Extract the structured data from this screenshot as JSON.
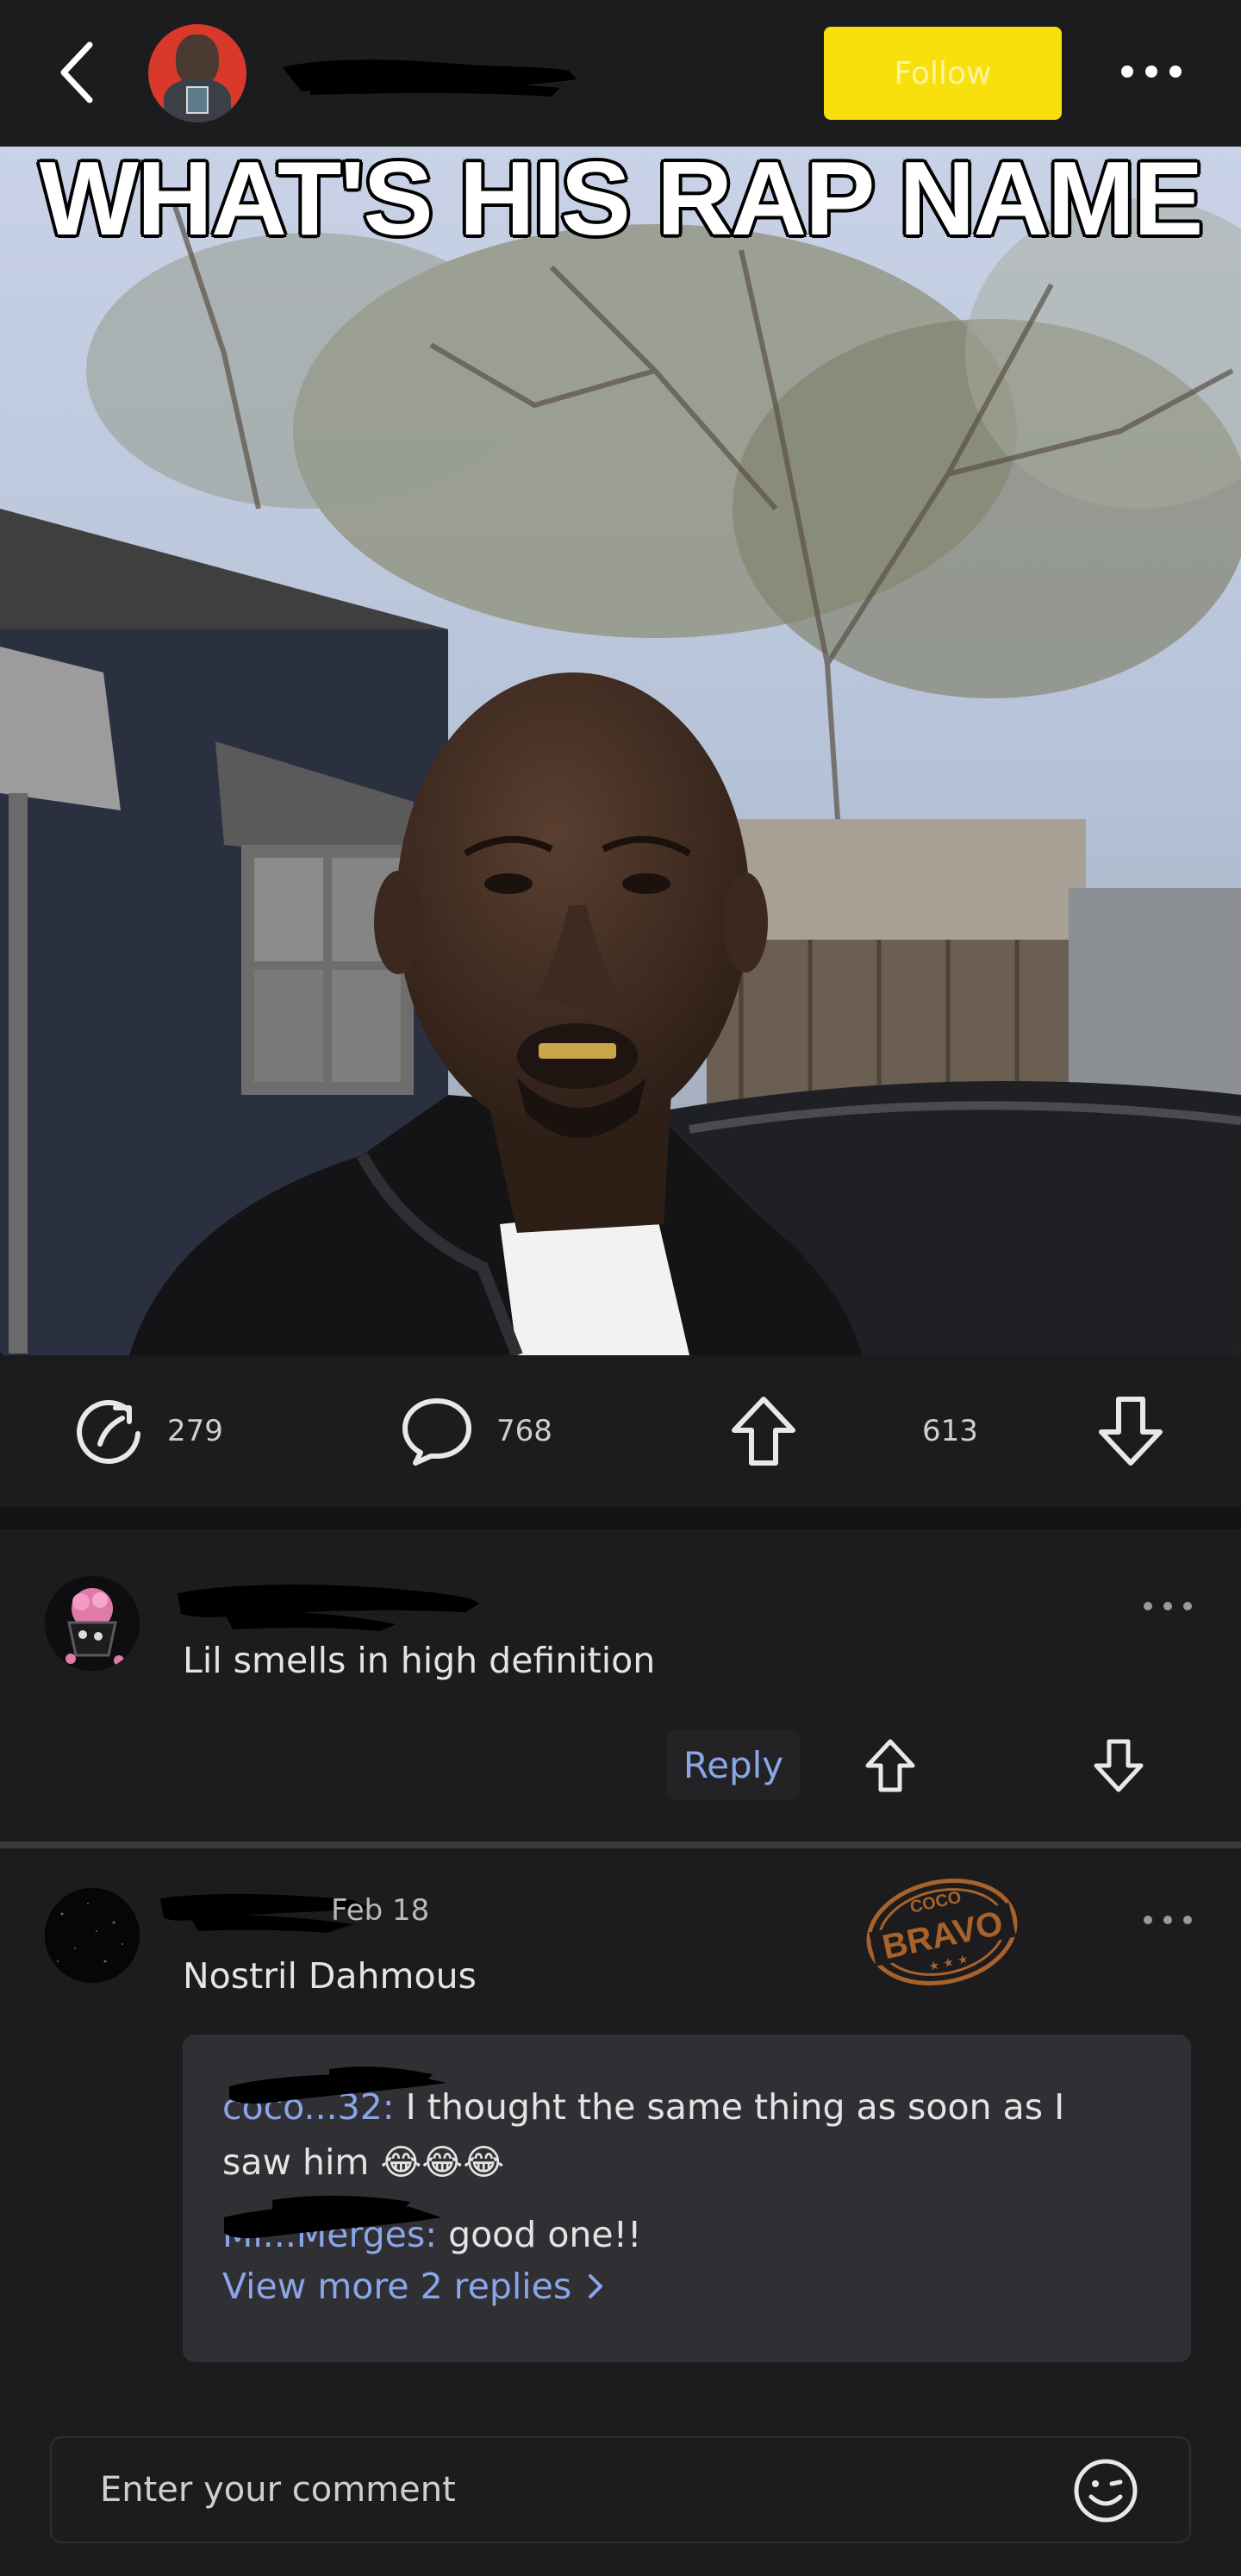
{
  "header": {
    "follow_label": "Follow"
  },
  "post": {
    "image_caption": "WHAT'S HIS RAP NAME",
    "stats": {
      "shares": "279",
      "comments": "768",
      "upvotes": "613"
    }
  },
  "comments": [
    {
      "text": "Lil smells in high definition",
      "reply_label": "Reply"
    },
    {
      "date": "Feb 18",
      "text": "Nostril Dahmous",
      "badge": {
        "top": "COCO",
        "main": "BRAVO"
      },
      "replies": [
        {
          "name_visible": "coco...32:",
          "text": " I thought the same thing as soon as I",
          "text_cont": "saw him 😂😂😂"
        },
        {
          "name_visible": "Mi...Merges:",
          "text": " good one!!"
        }
      ],
      "view_more": "View more 2 replies"
    }
  ],
  "comment_input": {
    "placeholder": "Enter your comment"
  },
  "colors": {
    "background": "#1c1c1e",
    "accent_yellow": "#f8e00c",
    "link_blue": "#8aa6e8"
  }
}
